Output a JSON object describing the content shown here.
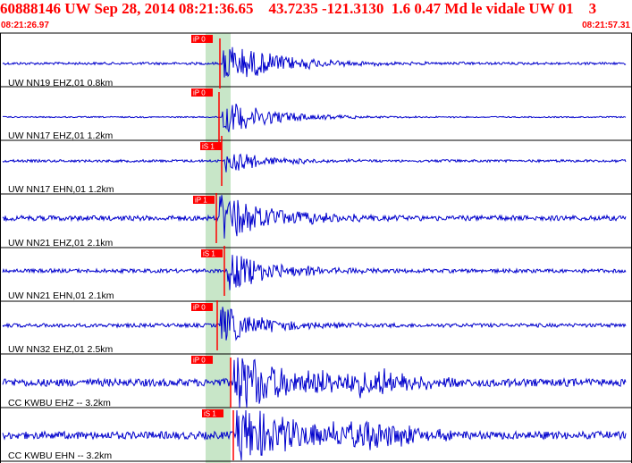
{
  "header": {
    "title": "60888146 UW Sep 28, 2014 08:21:36.65    43.7235 -121.3130  1.6 0.47 Md le vidale UW 01    3",
    "start_time": "08:21:26.97",
    "end_time": "08:21:57.31"
  },
  "colors": {
    "trace": "#0000cc",
    "pick": "#ff0000",
    "highlight": "#c8e6c8",
    "grid": "#000000"
  },
  "traces": [
    {
      "label": "UW NN19 EHZ,01 0.8km",
      "pick": "iP 0",
      "amp": 7,
      "noise": 2,
      "env": 28
    },
    {
      "label": "UW NN17 EHZ,01 1.2km",
      "pick": "iP 0",
      "amp": 6,
      "noise": 1,
      "env": 26
    },
    {
      "label": "UW NN17 EHN,01 1.2km",
      "pick": "iS 1",
      "amp": 5,
      "noise": 2,
      "env": 22
    },
    {
      "label": "UW NN21 EHZ,01 2.1km",
      "pick": "iP 1",
      "amp": 9,
      "noise": 4,
      "env": 26
    },
    {
      "label": "UW NN21 EHN,01 2.1km",
      "pick": "iS 1",
      "amp": 8,
      "noise": 3,
      "env": 24
    },
    {
      "label": "UW NN32 EHZ,01 2.5km",
      "pick": "iP 0",
      "amp": 8,
      "noise": 3,
      "env": 22
    },
    {
      "label": "CC KWBU EHZ -- 3.2km",
      "pick": "iP 0",
      "amp": 10,
      "noise": 6,
      "env": 30
    },
    {
      "label": "CC KWBU EHN -- 3.2km",
      "pick": "iS 1",
      "amp": 10,
      "noise": 6,
      "env": 30
    }
  ]
}
